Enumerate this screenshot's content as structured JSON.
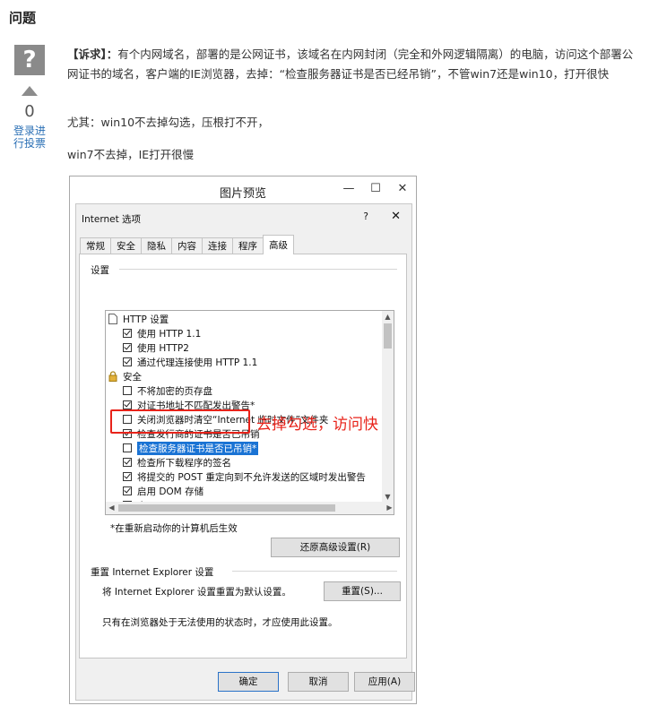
{
  "section": {
    "title": "问题"
  },
  "vote": {
    "icon": "question-mark-icon",
    "qmark": "?",
    "count": "0",
    "login_text": "登录进行投票"
  },
  "question": {
    "p1_prefix": "【诉求】：",
    "p1_body": "有个内网域名，部署的是公网证书，该域名在内网封闭（完全和外网逻辑隔离）的电脑，访问这个部署公网证书的域名，客户端的IE浏览器，去掉：“检查服务器证书是否已经吊销”，不管win7还是win10，打开很快",
    "p2": "尤其：win10不去掉勾选，压根打不开，",
    "p3": "win7不去掉，IE打开很慢"
  },
  "preview_window": {
    "title": "图片预览",
    "buttons": {
      "minimize": "—",
      "maximize": "☐",
      "close": "✕"
    }
  },
  "dialog": {
    "title": "Internet 选项",
    "help": "?",
    "close": "✕",
    "tabs": [
      "常规",
      "安全",
      "隐私",
      "内容",
      "连接",
      "程序",
      "高级"
    ],
    "active_tab": "高级",
    "settings_group_label": "设置",
    "settings_items": [
      {
        "type": "node",
        "icon": "page-icon",
        "label": "HTTP 设置"
      },
      {
        "type": "checkbox",
        "checked": true,
        "label": "使用 HTTP 1.1"
      },
      {
        "type": "checkbox",
        "checked": true,
        "label": "使用 HTTP2"
      },
      {
        "type": "checkbox",
        "checked": true,
        "label": "通过代理连接使用 HTTP 1.1"
      },
      {
        "type": "node",
        "icon": "lock-icon",
        "label": "安全"
      },
      {
        "type": "checkbox",
        "checked": false,
        "label": "不将加密的页存盘"
      },
      {
        "type": "checkbox",
        "checked": true,
        "label": "对证书地址不匹配发出警告*"
      },
      {
        "type": "checkbox",
        "checked": false,
        "label": "关闭浏览器时清空“Internet 临时文件”文件夹"
      },
      {
        "type": "checkbox",
        "checked": true,
        "label": "检查发行商的证书是否已吊销"
      },
      {
        "type": "checkbox",
        "checked": false,
        "label": "检查服务器证书是否已吊销*",
        "selected": true
      },
      {
        "type": "checkbox",
        "checked": true,
        "label": "检查所下载程序的签名"
      },
      {
        "type": "checkbox",
        "checked": true,
        "label": "将提交的 POST 重定向到不允许发送的区域时发出警告"
      },
      {
        "type": "checkbox",
        "checked": true,
        "label": "启用 DOM 存储"
      },
      {
        "type": "checkbox",
        "checked": true,
        "label": "启用 Windows Defender SmartScreen"
      }
    ],
    "restart_note": "*在重新启动你的计算机后生效",
    "restore_button": "还原高级设置(R)",
    "reset_group_label": "重置 Internet Explorer 设置",
    "reset_desc": "将 Internet Explorer 设置重置为默认设置。",
    "reset_button": "重置(S)...",
    "reset_note": "只有在浏览器处于无法使用的状态时，才应使用此设置。",
    "ok_button": "确定",
    "cancel_button": "取消",
    "apply_button": "应用(A)"
  },
  "annotation": {
    "text": "去掉勾选，访问快",
    "color": "#e8231a"
  },
  "colors": {
    "accent": "#1a73d4",
    "link": "#2a6fb5",
    "annotation": "#e8231a"
  }
}
